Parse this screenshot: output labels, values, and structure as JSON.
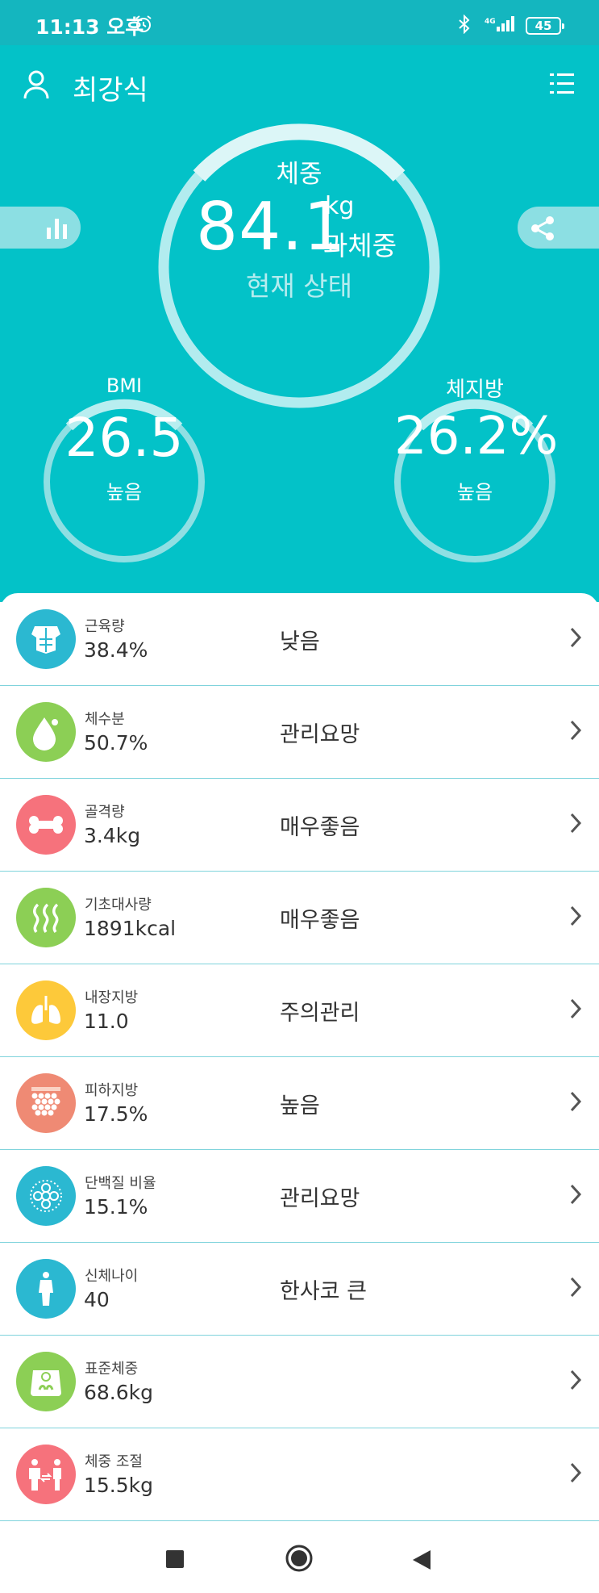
{
  "status_bar": {
    "time": "11:13 오후",
    "network": "4G",
    "battery": "45"
  },
  "header": {
    "username": "최강식"
  },
  "weight": {
    "label": "체중",
    "value": "84.1",
    "unit": "kg",
    "status": "과체중",
    "state_label": "현재 상태"
  },
  "bmi": {
    "label": "BMI",
    "value": "26.5",
    "level": "높음"
  },
  "body_fat": {
    "label": "체지방",
    "value": "26.2%",
    "level": "높음"
  },
  "metrics": [
    {
      "name": "근육량",
      "value": "38.4%",
      "level": "낮음",
      "icon": "muscle-icon",
      "color": "#2bb8d1"
    },
    {
      "name": "체수분",
      "value": "50.7%",
      "level": "관리요망",
      "icon": "water-drop-icon",
      "color": "#8ccf55"
    },
    {
      "name": "골격량",
      "value": "3.4kg",
      "level": "매우좋음",
      "icon": "bone-icon",
      "color": "#f6727c"
    },
    {
      "name": "기초대사량",
      "value": "1891kcal",
      "level": "매우좋음",
      "icon": "heat-waves-icon",
      "color": "#8ccf55"
    },
    {
      "name": "내장지방",
      "value": "11.0",
      "level": "주의관리",
      "icon": "lungs-icon",
      "color": "#fdc93a"
    },
    {
      "name": "피하지방",
      "value": "17.5%",
      "level": "높음",
      "icon": "fat-cells-icon",
      "color": "#ef8a74"
    },
    {
      "name": "단백질 비율",
      "value": "15.1%",
      "level": "관리요망",
      "icon": "protein-icon",
      "color": "#2bb8d1"
    },
    {
      "name": "신체나이",
      "value": "40",
      "level": "한사코 큰",
      "icon": "body-icon",
      "color": "#2bb8d1"
    },
    {
      "name": "표준체중",
      "value": "68.6kg",
      "level": "",
      "icon": "scale-icon",
      "color": "#8ccf55"
    },
    {
      "name": "체중 조절",
      "value": "15.5kg",
      "level": "",
      "icon": "weight-control-icon",
      "color": "#f6727c"
    }
  ]
}
